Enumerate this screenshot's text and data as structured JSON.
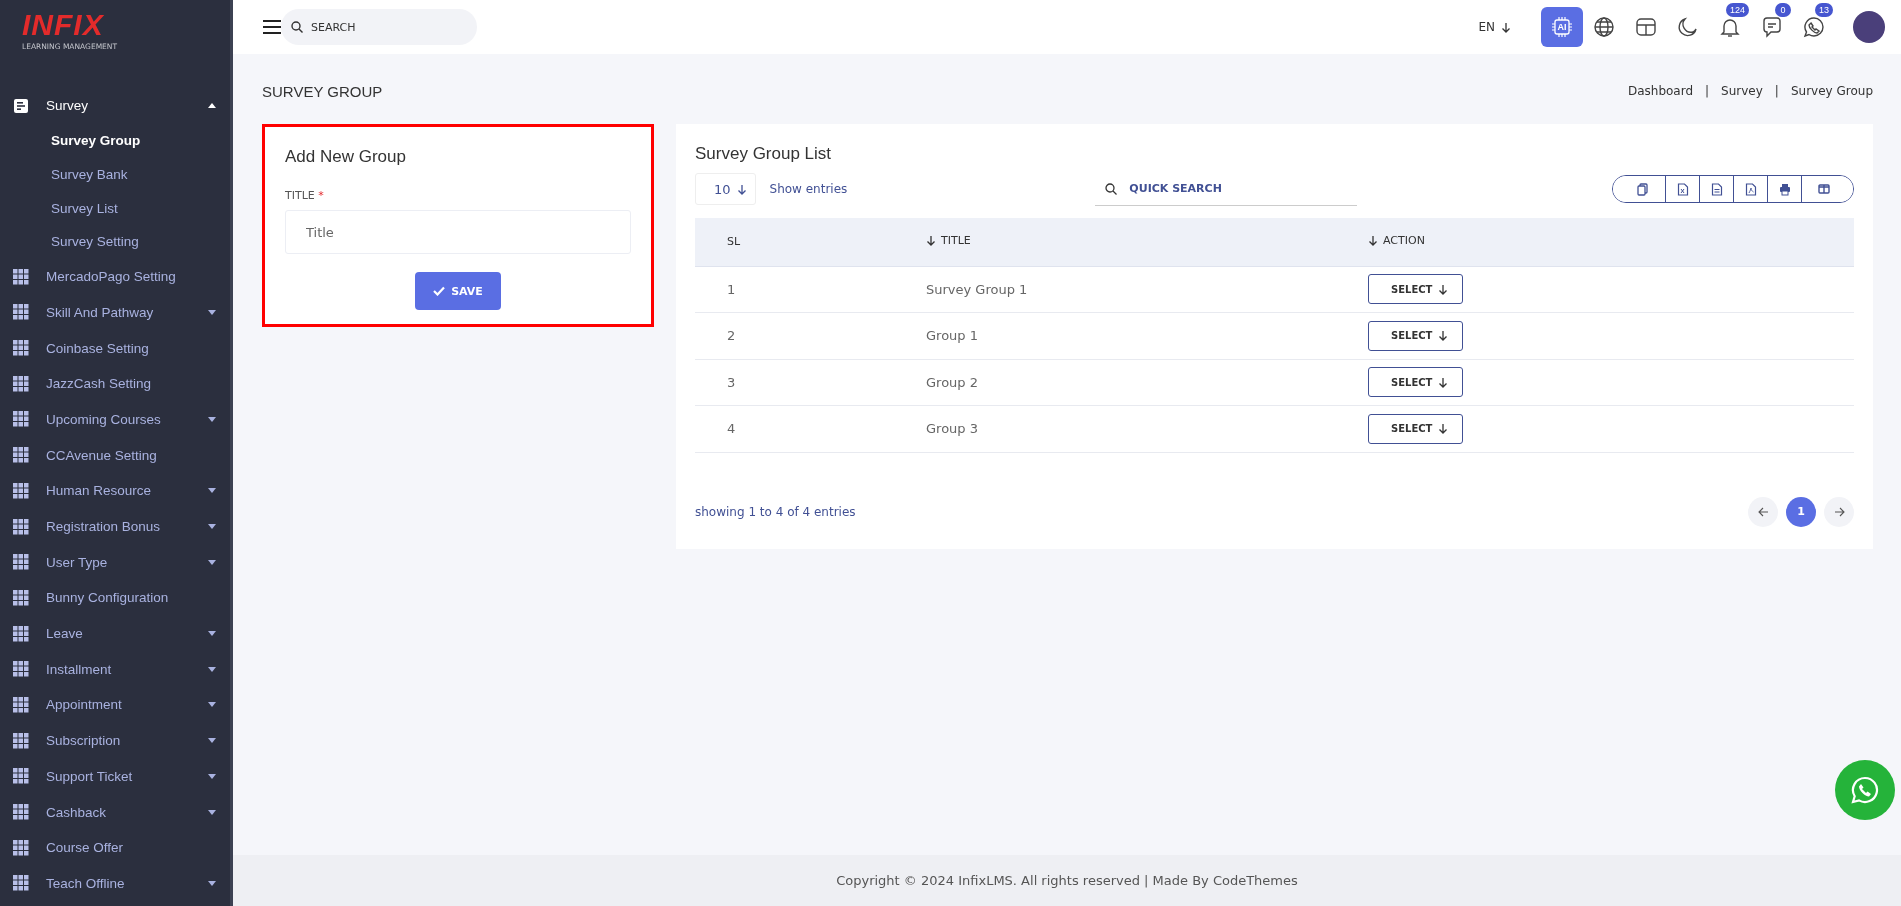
{
  "logo": {
    "mark": "INFIX",
    "tagline": "LEARNING MANAGEMENT"
  },
  "sidebar": {
    "items": [
      {
        "label": "Survey",
        "kind": "section",
        "expandable": true,
        "expanded": true,
        "children": [
          {
            "label": "Survey Group",
            "selected": true
          },
          {
            "label": "Survey Bank",
            "selected": false
          },
          {
            "label": "Survey List",
            "selected": false
          },
          {
            "label": "Survey Setting",
            "selected": false
          }
        ]
      },
      {
        "label": "MercadoPago Setting",
        "kind": "module",
        "expandable": false,
        "expanded": false
      },
      {
        "label": "Skill And Pathway",
        "kind": "module",
        "expandable": true,
        "expanded": false
      },
      {
        "label": "Coinbase Setting",
        "kind": "module",
        "expandable": false,
        "expanded": false
      },
      {
        "label": "JazzCash Setting",
        "kind": "module",
        "expandable": false,
        "expanded": false
      },
      {
        "label": "Upcoming Courses",
        "kind": "module",
        "expandable": true,
        "expanded": false
      },
      {
        "label": "CCAvenue Setting",
        "kind": "module",
        "expandable": false,
        "expanded": false
      },
      {
        "label": "Human Resource",
        "kind": "module",
        "expandable": true,
        "expanded": false
      },
      {
        "label": "Registration Bonus",
        "kind": "module",
        "expandable": true,
        "expanded": false
      },
      {
        "label": "User Type",
        "kind": "module",
        "expandable": true,
        "expanded": false
      },
      {
        "label": "Bunny Configuration",
        "kind": "module",
        "expandable": false,
        "expanded": false
      },
      {
        "label": "Leave",
        "kind": "module",
        "expandable": true,
        "expanded": false
      },
      {
        "label": "Installment",
        "kind": "module",
        "expandable": true,
        "expanded": false
      },
      {
        "label": "Appointment",
        "kind": "module",
        "expandable": true,
        "expanded": false
      },
      {
        "label": "Subscription",
        "kind": "module",
        "expandable": true,
        "expanded": false
      },
      {
        "label": "Support Ticket",
        "kind": "module",
        "expandable": true,
        "expanded": false
      },
      {
        "label": "Cashback",
        "kind": "module",
        "expandable": true,
        "expanded": false
      },
      {
        "label": "Course Offer",
        "kind": "module",
        "expandable": false,
        "expanded": false
      },
      {
        "label": "Teach Offline",
        "kind": "module",
        "expandable": true,
        "expanded": false
      }
    ]
  },
  "topbar": {
    "search": {
      "placeholder": "SEARCH"
    },
    "language": "EN",
    "actions": [
      {
        "kind": "ai",
        "label": "AI"
      },
      {
        "kind": "globe"
      },
      {
        "kind": "layout"
      },
      {
        "kind": "moon"
      },
      {
        "kind": "bell",
        "badge": "124"
      },
      {
        "kind": "chat",
        "badge": "0"
      },
      {
        "kind": "phone",
        "badge": "13"
      },
      {
        "kind": "avatar"
      }
    ]
  },
  "page": {
    "title": "SURVEY GROUP",
    "breadcrumbs": [
      "Dashboard",
      "Survey",
      "Survey Group"
    ],
    "breadcrumb_separator": "|"
  },
  "form": {
    "title": "Add New Group",
    "highlighted": true,
    "field": {
      "label": "TITLE",
      "required_mark": "*",
      "placeholder": "Title"
    },
    "button": "SAVE"
  },
  "list": {
    "title": "Survey Group List",
    "page_size": "10",
    "show_entries": "Show entries",
    "search": {
      "placeholder": "QUICK SEARCH"
    },
    "exports": [
      {
        "kind": "copy"
      },
      {
        "kind": "excel"
      },
      {
        "kind": "csv"
      },
      {
        "kind": "pdf"
      },
      {
        "kind": "print"
      },
      {
        "kind": "columns"
      }
    ],
    "columns": [
      {
        "label": "SL",
        "sortable": false
      },
      {
        "label": "TITLE",
        "sortable": true
      },
      {
        "label": "ACTION",
        "sortable": true
      }
    ],
    "rows": [
      {
        "sl": "1",
        "title": "Survey Group 1",
        "action": "SELECT"
      },
      {
        "sl": "2",
        "title": "Group 1",
        "action": "SELECT"
      },
      {
        "sl": "3",
        "title": "Group 2",
        "action": "SELECT"
      },
      {
        "sl": "4",
        "title": "Group 3",
        "action": "SELECT"
      }
    ],
    "summary": "showing 1 to 4 of 4 entries",
    "pages": [
      {
        "label": "1",
        "selected": true
      }
    ]
  },
  "footer": "Copyright © 2024 InfixLMS. All rights reserved | Made By CodeThemes"
}
